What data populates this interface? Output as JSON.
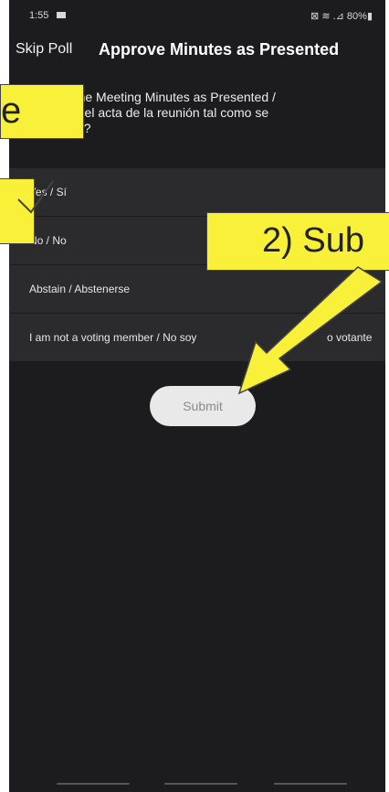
{
  "status_bar": {
    "time": "1:55",
    "right": "⊠ ≋ .⊿ 80%▮"
  },
  "header": {
    "skip_poll_label": "Skip Poll",
    "title": "Approve Minutes as Presented"
  },
  "poll": {
    "question_line1": "e the Meeting Minutes as Presented /",
    "question_line2": "r el acta de la reunión tal como se",
    "question_line3": "ó?",
    "options": [
      {
        "label": "Yes / Sí"
      },
      {
        "label": "No / No"
      },
      {
        "label": "Abstain / Abstenerse"
      },
      {
        "label": "I am not a voting member / No soy"
      },
      {
        "label": "o votante"
      }
    ],
    "submit_label": "Submit"
  },
  "annotations": {
    "callout_1_text": "e",
    "callout_2_text": "2) Sub",
    "color": "#f9f03a"
  }
}
